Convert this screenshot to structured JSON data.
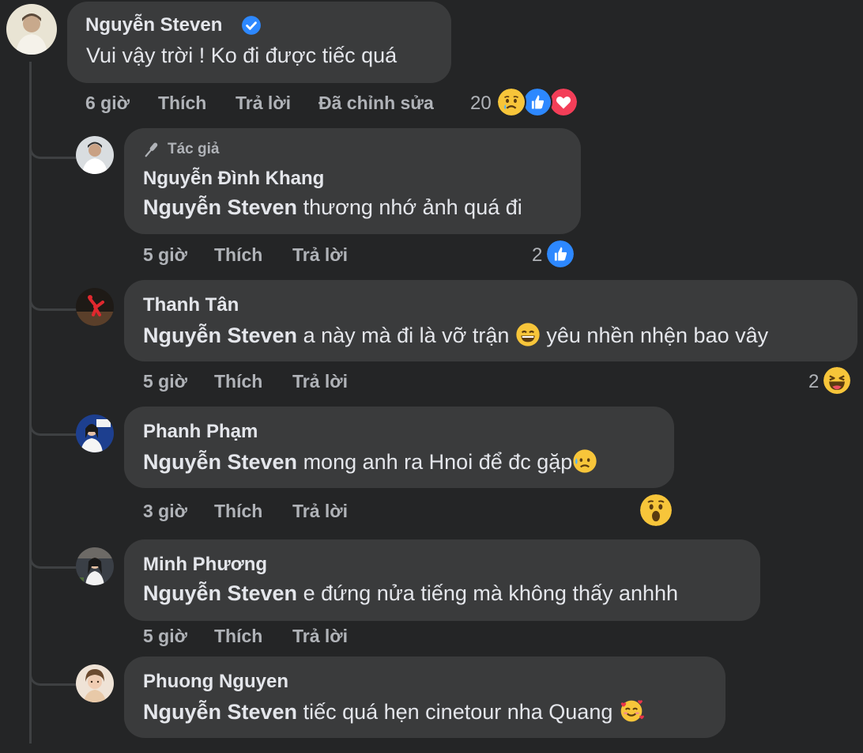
{
  "main_comment": {
    "author": "Nguyễn Steven",
    "verified_icon": "verified-badge-icon",
    "text": "Vui vậy trời ! Ko đi được tiếc quá",
    "time": "6 giờ",
    "like_label": "Thích",
    "reply_label": "Trả lời",
    "edited_label": "Đã chỉnh sửa",
    "reaction_count": "20",
    "reactions": [
      "sad-crying-icon",
      "like-icon",
      "love-icon"
    ]
  },
  "replies": [
    {
      "badge": "Tác giả",
      "author": "Nguyễn Đình Khang",
      "mention": "Nguyễn Steven",
      "text": " thương nhớ ảnh quá đi",
      "time": "5 giờ",
      "like_label": "Thích",
      "reply_label": "Trả lời",
      "reaction_count": "2",
      "reactions": [
        "like-icon"
      ]
    },
    {
      "author": "Thanh Tân",
      "mention": "Nguyễn Steven",
      "text": " a này mà đi là vỡ trận ",
      "text_after": " yêu nhền nhện bao vây",
      "inline_emoji": "grinning-face-icon",
      "time": "5 giờ",
      "like_label": "Thích",
      "reply_label": "Trả lời",
      "reaction_count": "2",
      "reactions": [
        "haha-icon"
      ]
    },
    {
      "author": "Phanh Phạm",
      "mention": "Nguyễn Steven",
      "text": " mong anh ra Hnoi để đc gặp",
      "inline_emoji": "sad-sweat-face-icon",
      "time": "3 giờ",
      "like_label": "Thích",
      "reply_label": "Trả lời",
      "reactions": [
        "wow-icon"
      ]
    },
    {
      "author": "Minh Phương",
      "mention": "Nguyễn Steven",
      "text": " e đứng nửa tiếng mà không thấy anhhh",
      "time": "5 giờ",
      "like_label": "Thích",
      "reply_label": "Trả lời"
    },
    {
      "author": "Phuong Nguyen",
      "mention": "Nguyễn Steven",
      "text": " tiếc quá hẹn cinetour nha Quang ",
      "inline_emoji": "smiling-hearts-face-icon",
      "time": "",
      "like_label": "",
      "reply_label": ""
    }
  ]
}
